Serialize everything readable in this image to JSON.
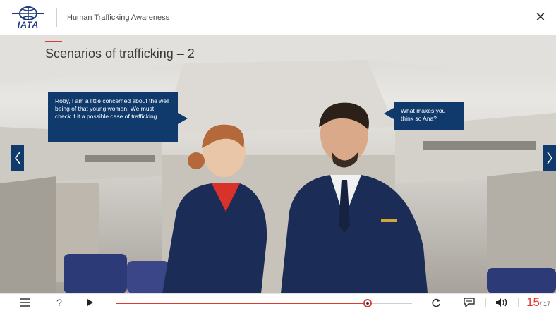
{
  "header": {
    "logo_text": "IATA",
    "course_title": "Human Trafficking Awareness",
    "close_label": "✕"
  },
  "slide": {
    "title": "Scenarios of trafficking – 2",
    "bubble_left": "Roby, I am a little concerned about the well being of that young woman. We must check if it a possible case of trafficking.",
    "bubble_right": "What makes you think so Ana?",
    "prev_icon": "chevron-left-icon",
    "next_icon": "chevron-right-icon"
  },
  "controls": {
    "menu_icon": "hamburger-menu-icon",
    "help_label": "?",
    "play_icon": "play-icon",
    "progress": 0.85,
    "replay_icon": "replay-icon",
    "transcript_icon": "speech-bubble-icon",
    "volume_icon": "speaker-icon",
    "page_current": "15",
    "page_total": "/ 17"
  },
  "colors": {
    "navy": "#0f3a6b",
    "accent_red": "#e03a2f"
  }
}
